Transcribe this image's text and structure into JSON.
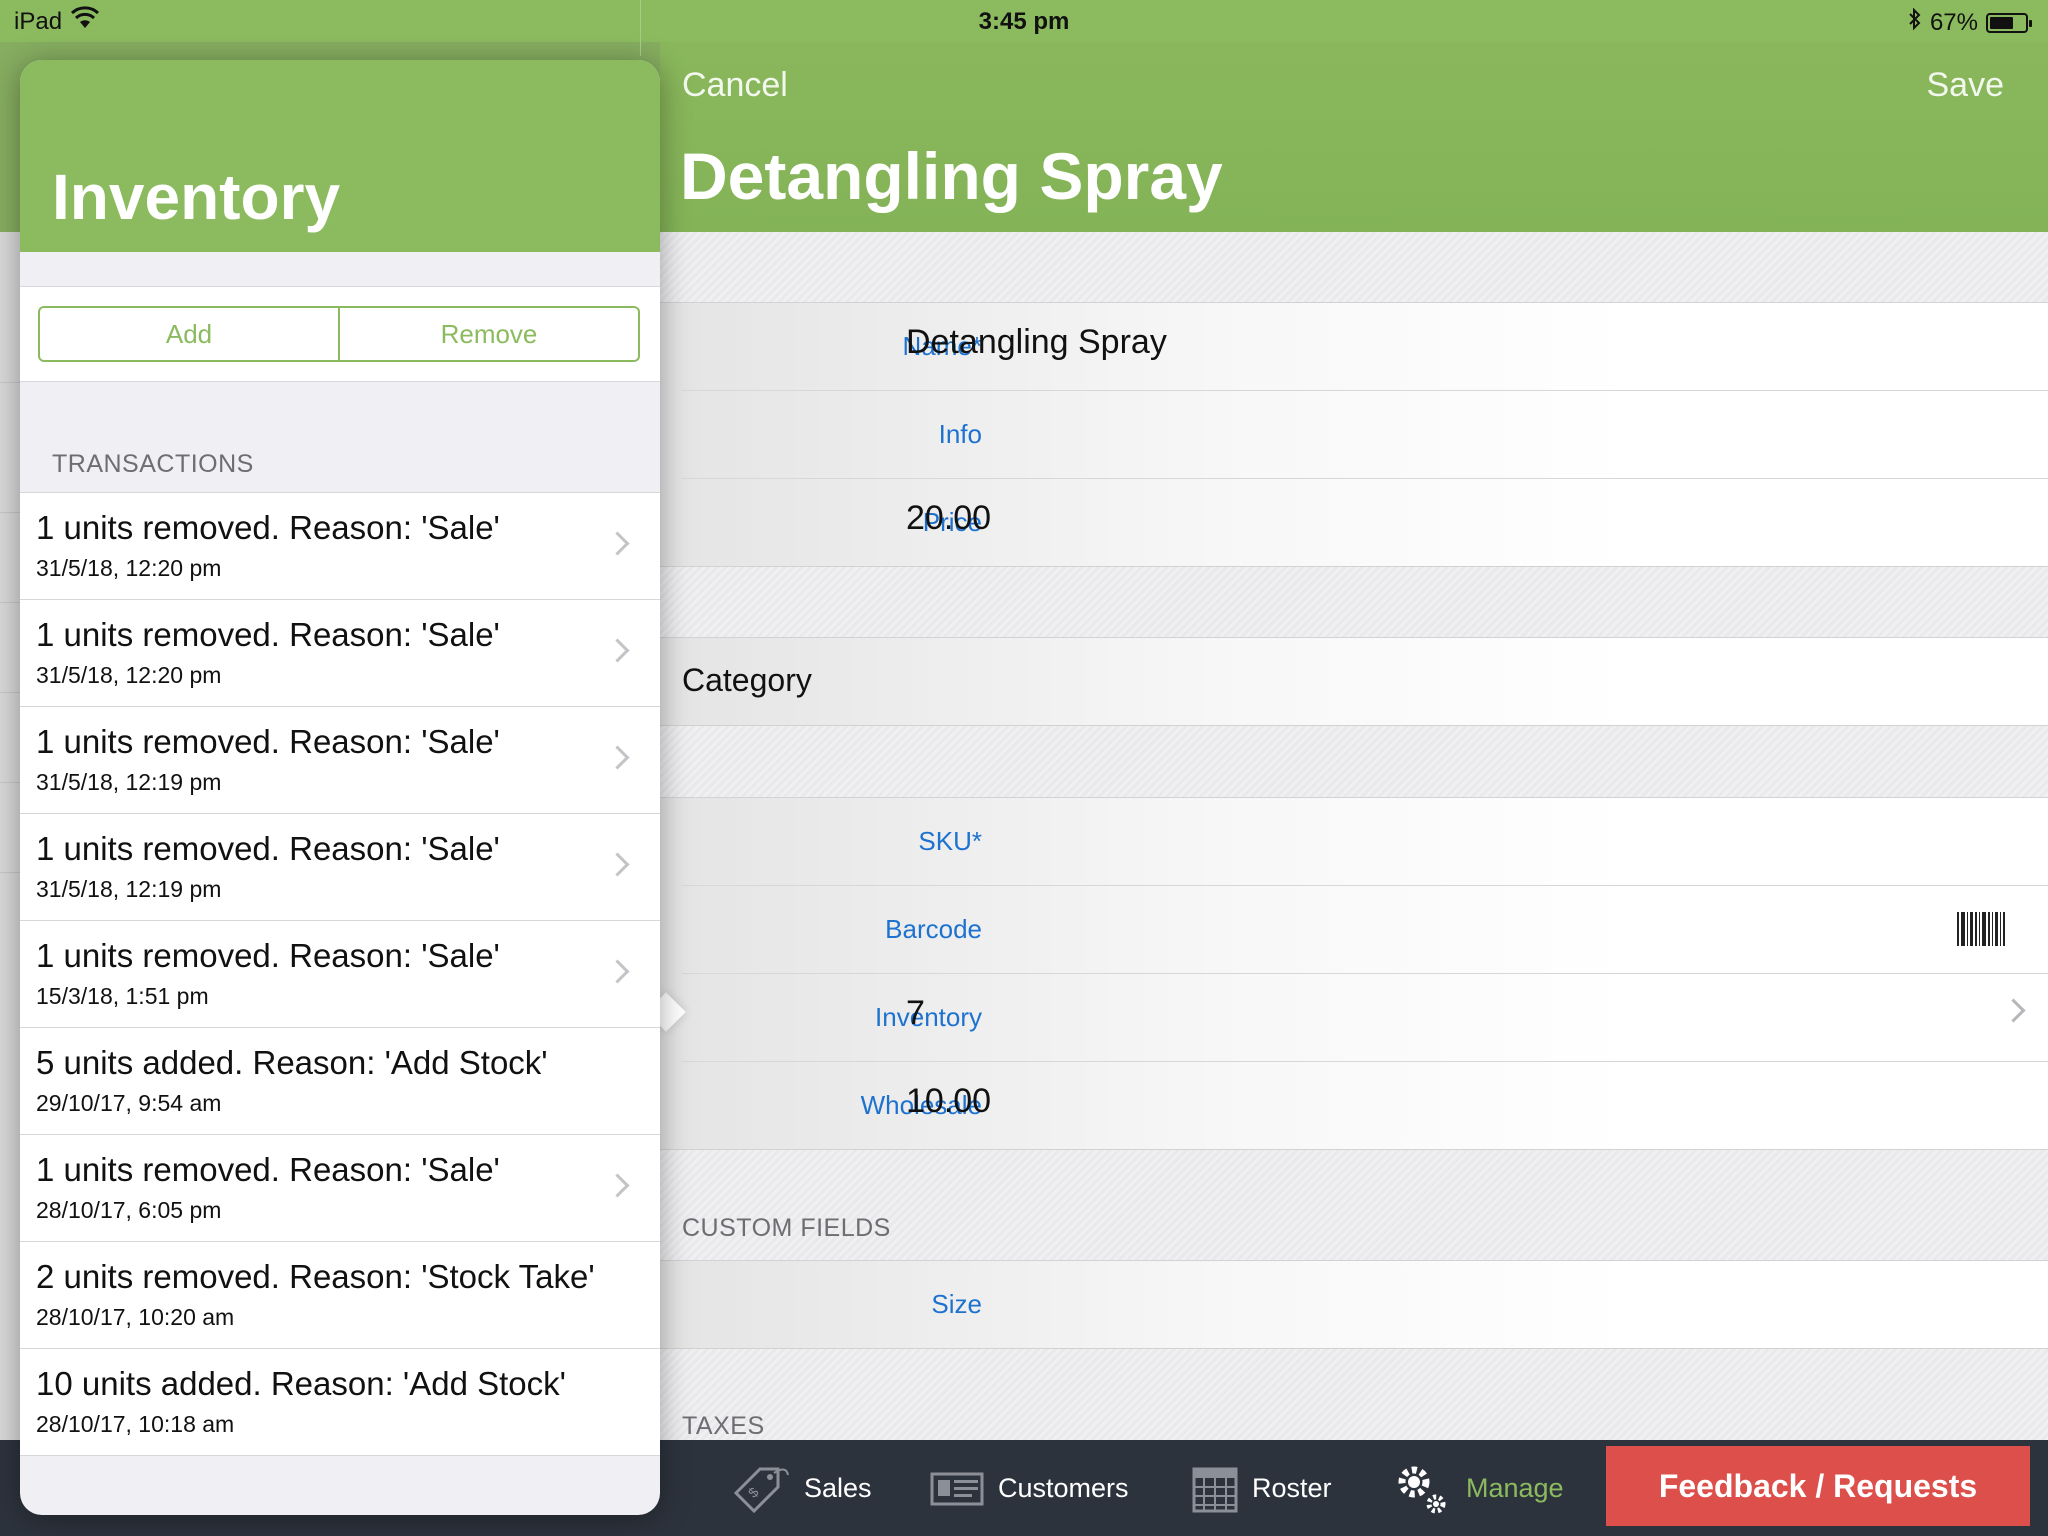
{
  "status_bar": {
    "carrier": "iPad",
    "time": "3:45 pm",
    "battery": "67%",
    "battery_level": 0.67
  },
  "nav": {
    "cancel": "Cancel",
    "save": "Save",
    "title": "Detangling Spray"
  },
  "form": {
    "name_label": "Name*",
    "name_value": "Detangling Spray",
    "info_label": "Info",
    "info_value": "",
    "price_label": "Price",
    "price_value": "20.00",
    "category_label": "Category",
    "sku_label": "SKU*",
    "sku_value": "",
    "barcode_label": "Barcode",
    "barcode_value": "",
    "inventory_label": "Inventory",
    "inventory_value": "7",
    "wholesale_label": "Wholesale",
    "wholesale_value": "10.00",
    "custom_fields_header": "CUSTOM FIELDS",
    "size_label": "Size",
    "size_value": "",
    "taxes_header": "TAXES"
  },
  "popover": {
    "title": "Inventory",
    "add": "Add",
    "remove": "Remove",
    "transactions_header": "TRANSACTIONS",
    "transactions": [
      {
        "text": "1 units removed. Reason: 'Sale'",
        "date": "31/5/18, 12:20 pm",
        "chevron": true
      },
      {
        "text": "1 units removed. Reason: 'Sale'",
        "date": "31/5/18, 12:20 pm",
        "chevron": true
      },
      {
        "text": "1 units removed. Reason: 'Sale'",
        "date": "31/5/18, 12:19 pm",
        "chevron": true
      },
      {
        "text": "1 units removed. Reason: 'Sale'",
        "date": "31/5/18, 12:19 pm",
        "chevron": true
      },
      {
        "text": "1 units removed. Reason: 'Sale'",
        "date": "15/3/18, 1:51 pm",
        "chevron": true
      },
      {
        "text": "5 units added. Reason: 'Add Stock'",
        "date": "29/10/17, 9:54 am",
        "chevron": false
      },
      {
        "text": "1 units removed. Reason: 'Sale'",
        "date": "28/10/17, 6:05 pm",
        "chevron": true
      },
      {
        "text": "2 units removed. Reason: 'Stock Take'",
        "date": "28/10/17, 10:20 am",
        "chevron": false
      },
      {
        "text": "10 units added. Reason: 'Add Stock'",
        "date": "28/10/17, 10:18 am",
        "chevron": false
      }
    ]
  },
  "tabbar": {
    "sales": "Sales",
    "customers": "Customers",
    "roster": "Roster",
    "manage": "Manage",
    "feedback": "Feedback / Requests",
    "active_color": "#8cbb5f",
    "feedback_color": "#dc4f4a"
  }
}
